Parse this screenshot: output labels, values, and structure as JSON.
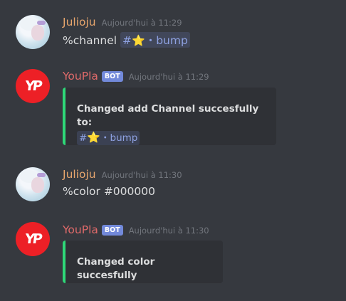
{
  "messages": [
    {
      "username": "Julioju",
      "timestamp": "Aujourd'hui à 11:29",
      "text": "%channel",
      "mention": {
        "hash": "#",
        "star": "⭐",
        "dot": "・",
        "name": "bump"
      }
    },
    {
      "username": "YouPla",
      "bot_badge": "BOT",
      "timestamp": "Aujourd'hui à 11:29",
      "embed": {
        "text": "Changed add Channel succesfully to:",
        "mention": {
          "hash": "#",
          "star": "⭐",
          "dot": "・",
          "name": "bump"
        },
        "color": "#2ed878"
      }
    },
    {
      "username": "Julioju",
      "timestamp": "Aujourd'hui à 11:30",
      "text": "%color #000000"
    },
    {
      "username": "YouPla",
      "bot_badge": "BOT",
      "timestamp": "Aujourd'hui à 11:30",
      "embed": {
        "text": "Changed color succesfully",
        "color": "#2ed878"
      }
    }
  ],
  "avatars": {
    "julioju": "anime-avatar",
    "youpla": {
      "logo": "YP",
      "color": "#ed2026"
    }
  },
  "colors": {
    "background": "#36393f",
    "embed_background": "#2f3136",
    "julioju_name": "#e8a66d",
    "youpla_name": "#e06a6a",
    "bot_badge": "#7289da",
    "mention": "#8ea1e1"
  }
}
